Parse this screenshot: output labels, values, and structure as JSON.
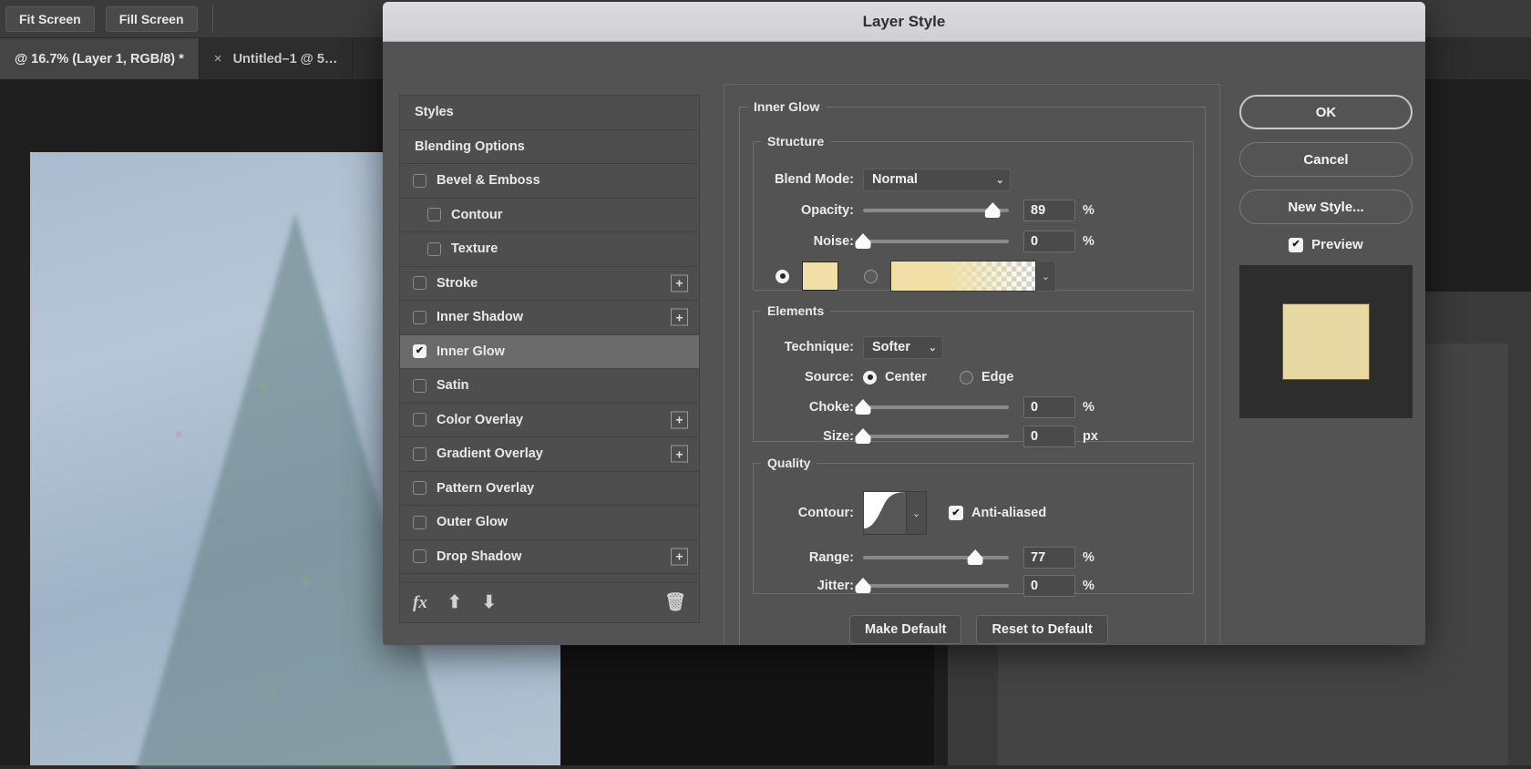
{
  "app": {
    "options_bar": {
      "fit_screen_label": "Fit Screen",
      "fill_screen_label": "Fill Screen"
    },
    "tabs": [
      {
        "label": "@ 16.7% (Layer 1, RGB/8) *",
        "active": true,
        "close_icon": "×"
      },
      {
        "label": "Untitled–1 @ 5…",
        "active": false,
        "close_icon": "×"
      }
    ]
  },
  "dialog": {
    "title": "Layer Style",
    "effects": [
      {
        "label": "Styles",
        "type": "header",
        "checkbox": null,
        "plus": false,
        "selected": false,
        "indent": false
      },
      {
        "label": "Blending Options",
        "type": "header",
        "checkbox": null,
        "plus": false,
        "selected": false,
        "indent": false
      },
      {
        "label": "Bevel & Emboss",
        "type": "effect",
        "checkbox": false,
        "plus": false,
        "selected": false,
        "indent": false
      },
      {
        "label": "Contour",
        "type": "effect",
        "checkbox": false,
        "plus": false,
        "selected": false,
        "indent": true
      },
      {
        "label": "Texture",
        "type": "effect",
        "checkbox": false,
        "plus": false,
        "selected": false,
        "indent": true
      },
      {
        "label": "Stroke",
        "type": "effect",
        "checkbox": false,
        "plus": true,
        "selected": false,
        "indent": false
      },
      {
        "label": "Inner Shadow",
        "type": "effect",
        "checkbox": false,
        "plus": true,
        "selected": false,
        "indent": false
      },
      {
        "label": "Inner Glow",
        "type": "effect",
        "checkbox": true,
        "plus": false,
        "selected": true,
        "indent": false
      },
      {
        "label": "Satin",
        "type": "effect",
        "checkbox": false,
        "plus": false,
        "selected": false,
        "indent": false
      },
      {
        "label": "Color Overlay",
        "type": "effect",
        "checkbox": false,
        "plus": true,
        "selected": false,
        "indent": false
      },
      {
        "label": "Gradient Overlay",
        "type": "effect",
        "checkbox": false,
        "plus": true,
        "selected": false,
        "indent": false
      },
      {
        "label": "Pattern Overlay",
        "type": "effect",
        "checkbox": false,
        "plus": false,
        "selected": false,
        "indent": false
      },
      {
        "label": "Outer Glow",
        "type": "effect",
        "checkbox": false,
        "plus": false,
        "selected": false,
        "indent": false
      },
      {
        "label": "Drop Shadow",
        "type": "effect",
        "checkbox": false,
        "plus": true,
        "selected": false,
        "indent": false
      }
    ],
    "effects_toolbar": {
      "fx_icon": "fx",
      "move_up_icon": "⬆",
      "move_down_icon": "⬇",
      "delete_icon": "🗑"
    },
    "panel": {
      "group_title": "Inner Glow",
      "structure": {
        "title": "Structure",
        "blend_mode_label": "Blend Mode:",
        "blend_mode_value": "Normal",
        "opacity_label": "Opacity:",
        "opacity_value": "89",
        "opacity_unit": "%",
        "opacity_percent": 89,
        "noise_label": "Noise:",
        "noise_value": "0",
        "noise_unit": "%",
        "noise_percent": 0,
        "fill_type": "color",
        "color_hex": "#f0e0a8",
        "gradient_start_hex": "#f0e0a8",
        "gradient_end": "transparent"
      },
      "elements": {
        "title": "Elements",
        "technique_label": "Technique:",
        "technique_value": "Softer",
        "source_label": "Source:",
        "source_center_label": "Center",
        "source_edge_label": "Edge",
        "source_value": "Center",
        "choke_label": "Choke:",
        "choke_value": "0",
        "choke_unit": "%",
        "choke_percent": 0,
        "size_label": "Size:",
        "size_value": "0",
        "size_unit": "px",
        "size_percent": 0
      },
      "quality": {
        "title": "Quality",
        "contour_label": "Contour:",
        "anti_aliased_label": "Anti-aliased",
        "anti_aliased_checked": true,
        "range_label": "Range:",
        "range_value": "77",
        "range_unit": "%",
        "range_percent": 77,
        "jitter_label": "Jitter:",
        "jitter_value": "0",
        "jitter_unit": "%",
        "jitter_percent": 0
      },
      "make_default_label": "Make Default",
      "reset_default_label": "Reset to Default"
    },
    "buttons": {
      "ok_label": "OK",
      "cancel_label": "Cancel",
      "new_style_label": "New Style...",
      "preview_label": "Preview",
      "preview_checked": true
    }
  }
}
